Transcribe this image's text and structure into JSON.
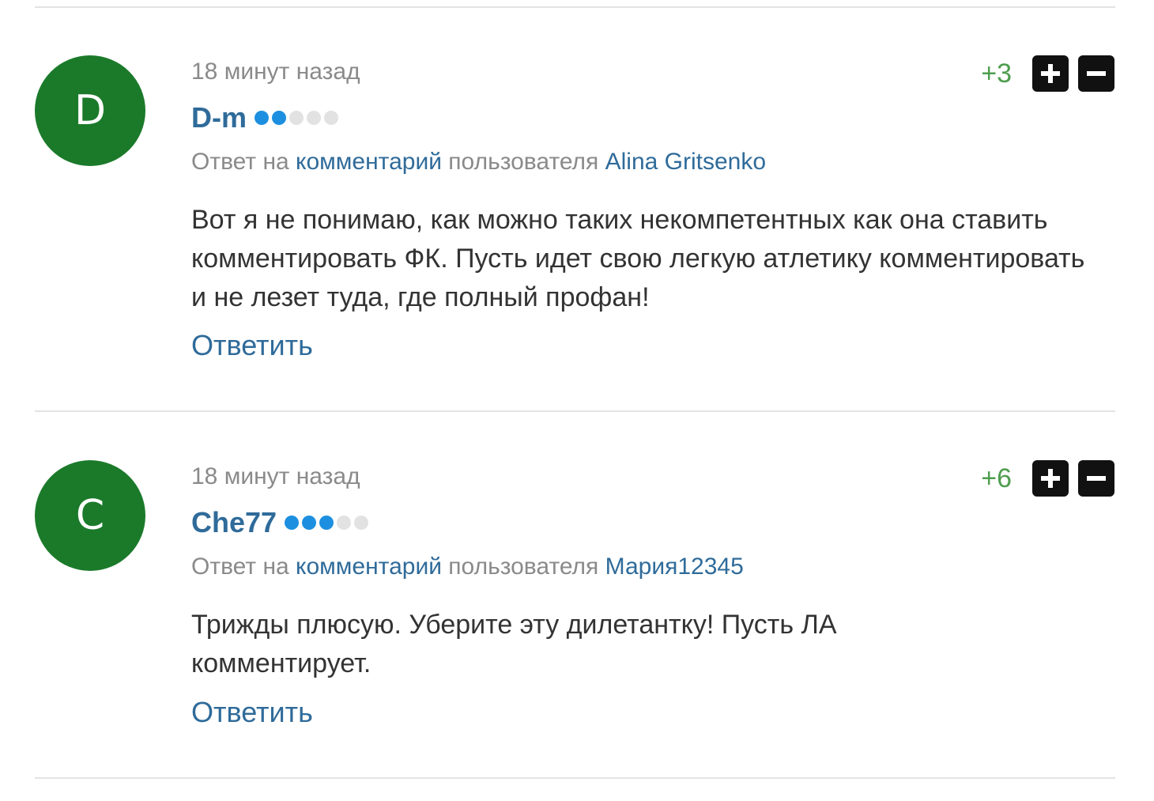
{
  "comments": [
    {
      "avatar_letter": "D",
      "time": "18 минут назад",
      "author": "D-m",
      "rank_dots": [
        true,
        true,
        false,
        false,
        false
      ],
      "reply_prefix": "Ответ на ",
      "reply_link": "комментарий",
      "reply_mid": " пользователя ",
      "reply_user": "Alina Gritsenko",
      "text": "Вот я не понимаю, как можно таких некомпетентных как она ставить комментировать ФК. Пусть идет свою легкую атлетику комментировать и не лезет туда, где полный профан!",
      "score": "+3",
      "reply_button": "Ответить",
      "avatar_color": "#1b7a2a"
    },
    {
      "avatar_letter": "C",
      "time": "18 минут назад",
      "author": "Che77",
      "rank_dots": [
        true,
        true,
        true,
        false,
        false
      ],
      "reply_prefix": "Ответ на ",
      "reply_link": "комментарий",
      "reply_mid": " пользователя ",
      "reply_user": "Мария12345",
      "text": "Трижды плюсую. Уберите эту дилетантку! Пусть ЛА комментирует.",
      "score": "+6",
      "reply_button": "Ответить",
      "avatar_color": "#1b7a2a"
    }
  ],
  "icons": {
    "upvote": "plus-icon",
    "downvote": "minus-icon"
  },
  "colors": {
    "link": "#2f6b9a",
    "score": "#4e9d4e",
    "rank_on": "#1d8fe0",
    "rank_off": "#e2e2e2"
  }
}
